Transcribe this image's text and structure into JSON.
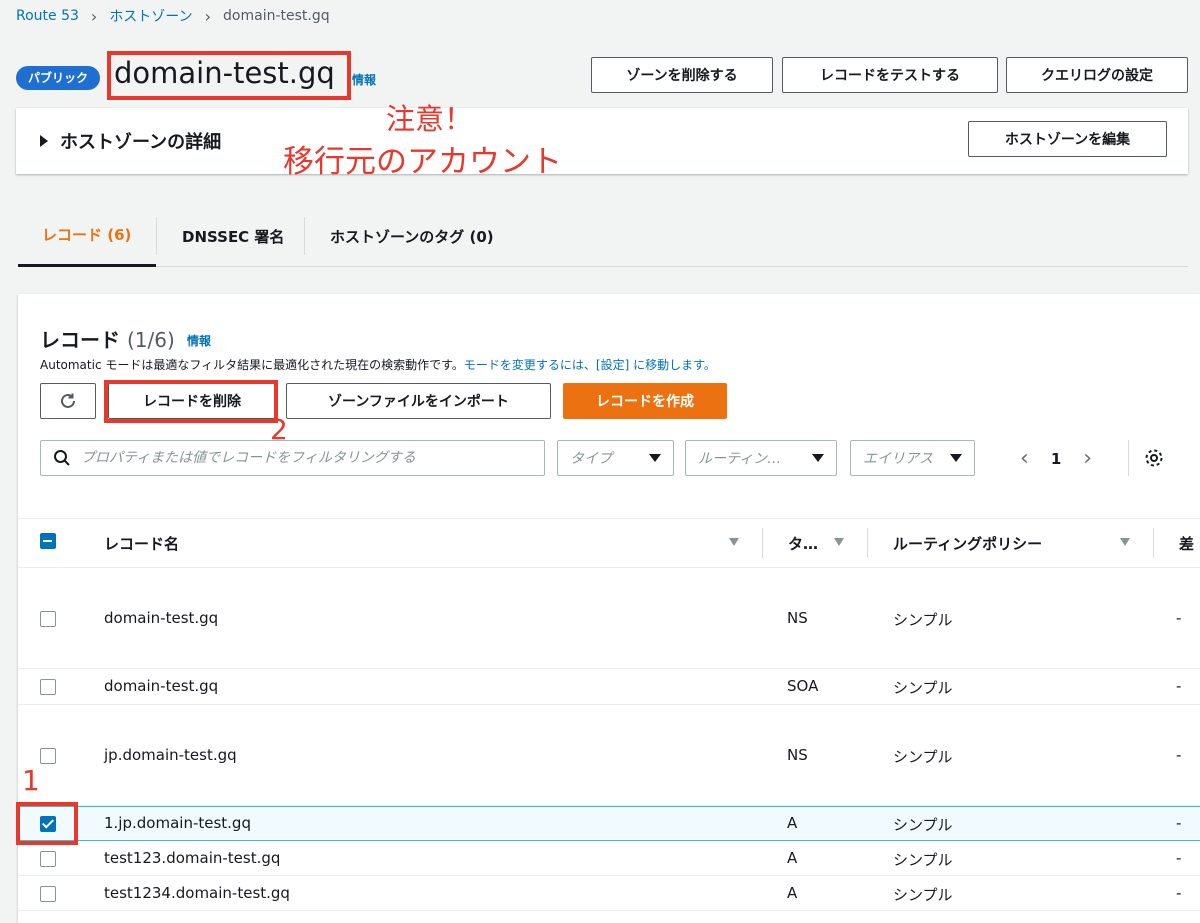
{
  "breadcrumb": {
    "items": [
      "Route 53",
      "ホストゾーン",
      "domain-test.gq"
    ]
  },
  "header": {
    "badge": "パブリック",
    "title": "domain-test.gq",
    "info": "情報",
    "buttons": {
      "delete_zone": "ゾーンを削除する",
      "test_record": "レコードをテストする",
      "query_log": "クエリログの設定"
    }
  },
  "annotations": {
    "warning_line1": "注意！",
    "warning_line2": "移行元のアカウント",
    "step1": "1",
    "step2": "2"
  },
  "details": {
    "title": "ホストゾーンの詳細",
    "edit_button": "ホストゾーンを編集"
  },
  "tabs": [
    {
      "label": "レコード (6)"
    },
    {
      "label": "DNSSEC 署名"
    },
    {
      "label": "ホストゾーンのタグ (0)"
    }
  ],
  "records": {
    "title": "レコード",
    "count": "(1/6)",
    "info": "情報",
    "desc_prefix": "Automatic モードは最適なフィルタ結果に最適化された現在の検索動作です。",
    "desc_link": "モードを変更するには、[設定] に移動します。",
    "buttons": {
      "delete": "レコードを削除",
      "import": "ゾーンファイルをインポート",
      "create": "レコードを作成"
    },
    "search_placeholder": "プロパティまたは値でレコードをフィルタリングする",
    "filters": {
      "type": "タイプ",
      "routing": "ルーティン…",
      "alias": "エイリアス"
    },
    "page": "1",
    "columns": {
      "name": "レコード名",
      "type": "タ…",
      "routing": "ルーティングポリシー",
      "extra": "差"
    },
    "rows": [
      {
        "name": "domain-test.gq",
        "type": "NS",
        "routing": "シンプル",
        "extra": "-",
        "checked": false
      },
      {
        "name": "domain-test.gq",
        "type": "SOA",
        "routing": "シンプル",
        "extra": "-",
        "checked": false
      },
      {
        "name": "jp.domain-test.gq",
        "type": "NS",
        "routing": "シンプル",
        "extra": "-",
        "checked": false
      },
      {
        "name": "1.jp.domain-test.gq",
        "type": "A",
        "routing": "シンプル",
        "extra": "-",
        "checked": true
      },
      {
        "name": "test123.domain-test.gq",
        "type": "A",
        "routing": "シンプル",
        "extra": "-",
        "checked": false
      },
      {
        "name": "test1234.domain-test.gq",
        "type": "A",
        "routing": "シンプル",
        "extra": "-",
        "checked": false
      }
    ]
  },
  "colors": {
    "accent": "#ec7211",
    "link": "#0073bb",
    "annotation": "#e8372b"
  }
}
